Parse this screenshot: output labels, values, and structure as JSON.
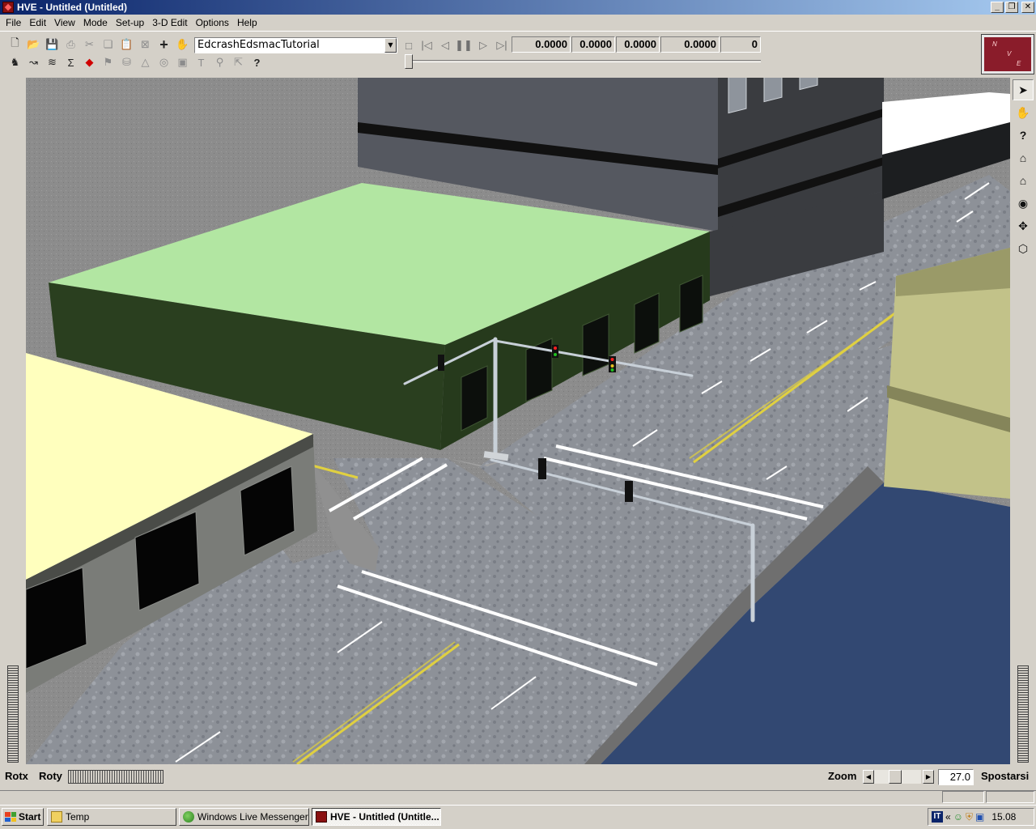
{
  "window": {
    "title": "HVE - Untitled (Untitled)"
  },
  "menu": [
    "File",
    "Edit",
    "View",
    "Mode",
    "Set-up",
    "3-D Edit",
    "Options",
    "Help"
  ],
  "toolbar": {
    "icons_row1": [
      "new-file",
      "open-folder",
      "save",
      "print",
      "cut",
      "copy",
      "paste",
      "delete",
      "add",
      "hand"
    ],
    "icons_row2": [
      "vehicle",
      "path",
      "terrain",
      "sum",
      "split",
      "flag",
      "cylinder",
      "cone",
      "target",
      "box",
      "text",
      "pin",
      "arrow",
      "help"
    ],
    "event_combo": "EdcrashEdsmacTutorial",
    "readouts": [
      "0.0000",
      "0.0000",
      "0.0000",
      "0.0000",
      "0"
    ],
    "nve_letters": [
      "N",
      "V",
      "E"
    ]
  },
  "side_tools": [
    "select-arrow",
    "pan-hand",
    "help-question",
    "home",
    "zoom-home",
    "eye",
    "move-cross",
    "perspective-cube"
  ],
  "bottom": {
    "rotx_label": "Rotx",
    "roty_label": "Roty",
    "zoom_label": "Zoom",
    "zoom_value": "27.0",
    "spostarsi_label": "Spostarsi"
  },
  "taskbar": {
    "start_label": "Start",
    "tasks": [
      {
        "label": "Temp",
        "icon": "folder-icon"
      },
      {
        "label": "Windows Live Messenger",
        "icon": "messenger-icon"
      },
      {
        "label": "HVE - Untitled (Untitle...",
        "icon": "hve-icon"
      }
    ],
    "tray_lang": "IT",
    "clock": "15.08"
  },
  "colors": {
    "titlebar_start": "#0a246a",
    "titlebar_end": "#a6caf0",
    "green_roof": "#b2e6a2",
    "green_wall": "#2a3f1f",
    "yellow_roof": "#ffffbe",
    "river": "#324872"
  }
}
